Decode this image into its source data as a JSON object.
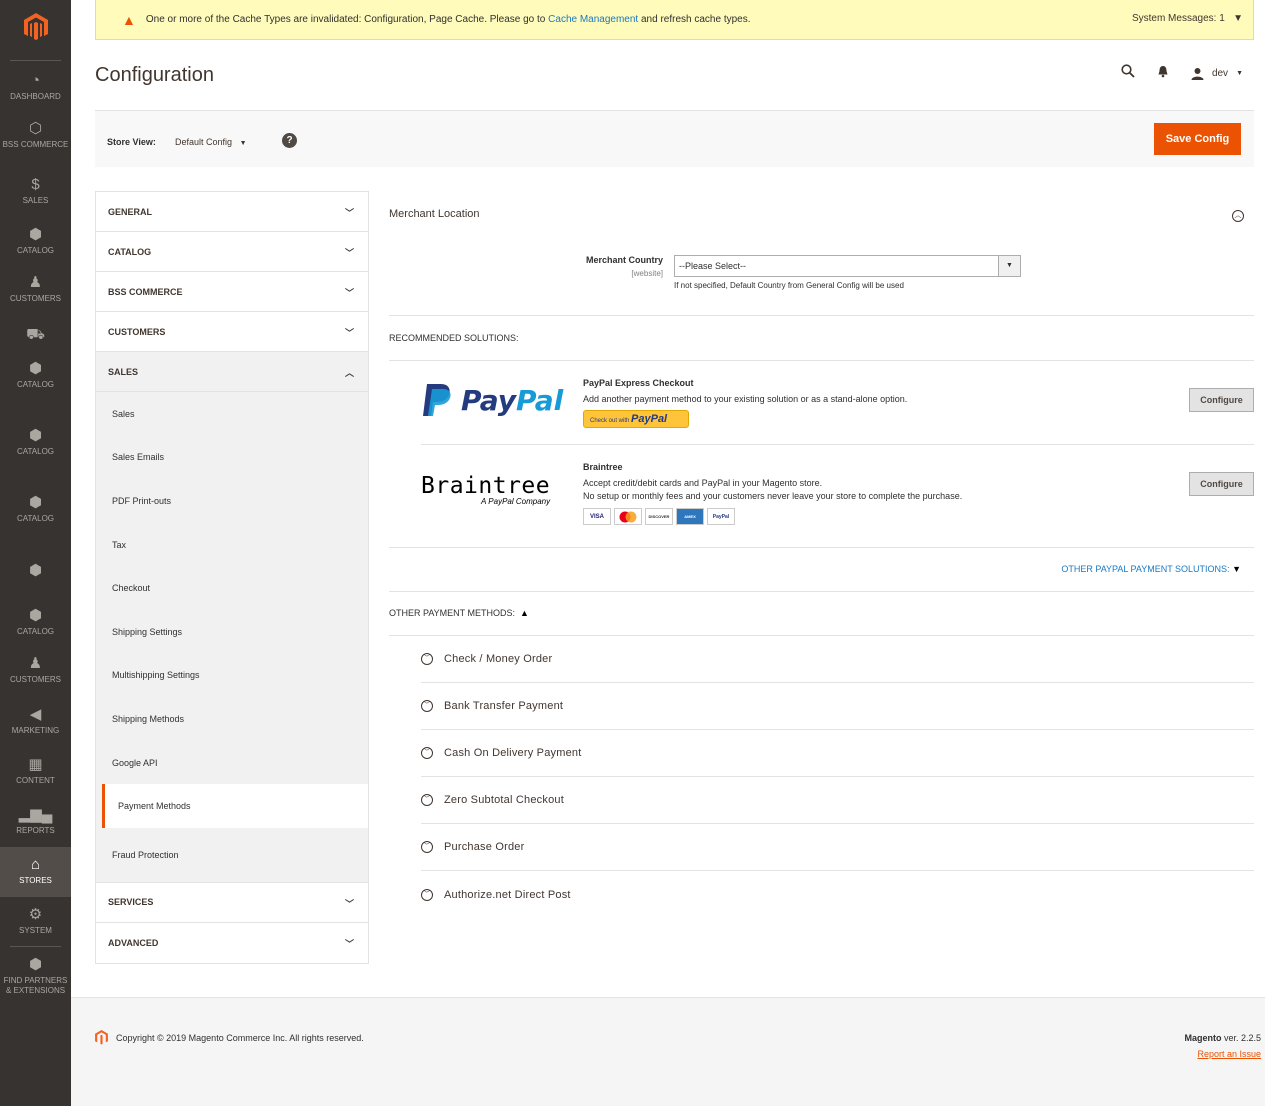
{
  "nav": {
    "items": [
      {
        "label": "DASHBOARD",
        "icon": "dashboard-icon",
        "glyph": "◔"
      },
      {
        "label": "BSS COMMERCE",
        "icon": "hexagon-icon",
        "glyph": "⬡"
      },
      {
        "label": "SALES",
        "icon": "dollar-icon",
        "glyph": "$"
      },
      {
        "label": "CATALOG",
        "icon": "box-icon",
        "glyph": "⬢"
      },
      {
        "label": "CUSTOMERS",
        "icon": "person-icon",
        "glyph": "♟"
      },
      {
        "label": "CATALOG",
        "icon": "box-icon",
        "glyph": "⬢"
      },
      {
        "label": "CATALOG",
        "icon": "box-icon",
        "glyph": "⬢"
      },
      {
        "label": "CATALOG",
        "icon": "box-icon",
        "glyph": "⬢"
      },
      {
        "label": "CATALOG",
        "icon": "box-icon",
        "glyph": "⬢"
      },
      {
        "label": "CUSTOMERS",
        "icon": "person-icon",
        "glyph": "♟"
      },
      {
        "label": "MARKETING",
        "icon": "megaphone-icon",
        "glyph": "📢"
      },
      {
        "label": "CONTENT",
        "icon": "content-icon",
        "glyph": "▦"
      },
      {
        "label": "REPORTS",
        "icon": "bar-chart-icon",
        "glyph": "▮"
      },
      {
        "label": "STORES",
        "icon": "store-icon",
        "glyph": "⌂"
      },
      {
        "label": "SYSTEM",
        "icon": "gear-icon",
        "glyph": "⚙"
      },
      {
        "label": "FIND PARTNERS & EXTENSIONS",
        "icon": "box-icon",
        "glyph": "⬢"
      }
    ]
  },
  "banner": {
    "message": "One or more of the Cache Types are invalidated: Configuration, Page Cache. Please go to",
    "link": "Cache Management",
    "suffix": "and refresh cache types.",
    "system_messages": "System Messages: 1"
  },
  "header": {
    "title": "Configuration",
    "user": "dev"
  },
  "storebar": {
    "label": "Store View:",
    "value": "Default Config",
    "help": "?",
    "save": "Save Config"
  },
  "tabs": {
    "general": "GENERAL",
    "catalog": "CATALOG",
    "bss": "BSS COMMERCE",
    "customers": "CUSTOMERS",
    "sales": "SALES",
    "services": "SERVICES",
    "advanced": "ADVANCED",
    "sales_items": [
      "Sales",
      "Sales Emails",
      "PDF Print-outs",
      "Tax",
      "Checkout",
      "Shipping Settings",
      "Multishipping Settings",
      "Shipping Methods",
      "Google API",
      "Payment Methods",
      "Fraud Protection"
    ]
  },
  "main": {
    "section_title": "Merchant Location",
    "merchant_country_label": "Merchant Country",
    "merchant_country_scope": "[website]",
    "merchant_country_value": "--Please Select--",
    "merchant_country_note": "If not specified, Default Country from General Config will be used",
    "recommended": "RECOMMENDED SOLUTIONS:",
    "paypal": {
      "logo_pay": "Pay",
      "logo_pal": "Pal",
      "title": "PayPal Express Checkout",
      "desc": "Add another payment method to your existing solution or as a stand-alone option.",
      "button_small": "Check out with",
      "button_brand": "PayPal",
      "configure": "Configure"
    },
    "braintree": {
      "logo": "Braintree",
      "logo_sub": "A PayPal Company",
      "title": "Braintree",
      "desc1": "Accept credit/debit cards and PayPal in your Magento store.",
      "desc2": "No setup or monthly fees and your customers never leave your store to complete the purchase.",
      "cards": [
        "VISA",
        "MC",
        "DISCOVER",
        "AMEX",
        "PayPal"
      ],
      "configure": "Configure"
    },
    "other_paypal": "OTHER PAYPAL PAYMENT SOLUTIONS:",
    "other_methods": "OTHER PAYMENT METHODS:",
    "methods": [
      "Check / Money Order",
      "Bank Transfer Payment",
      "Cash On Delivery Payment",
      "Zero Subtotal Checkout",
      "Purchase Order",
      "Authorize.net Direct Post"
    ]
  },
  "footer": {
    "copyright": "Copyright © 2019 Magento Commerce Inc. All rights reserved.",
    "brand": "Magento",
    "version": "ver. 2.2.5",
    "report": "Report an Issue"
  },
  "colors": {
    "accent": "#eb5202",
    "nav_bg": "#373330",
    "link": "#1979c3"
  }
}
